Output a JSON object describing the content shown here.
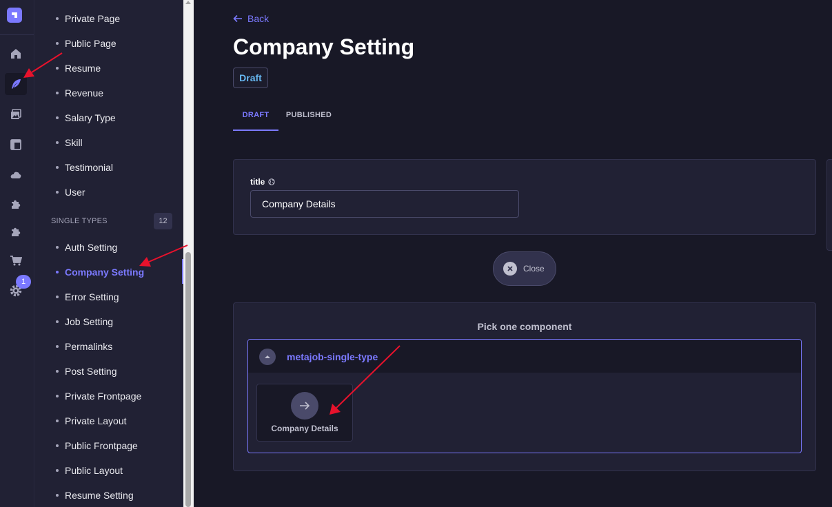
{
  "rail": {
    "items": [
      "home-icon",
      "feather-icon",
      "media-icon",
      "layout-icon",
      "cloud-icon",
      "puzzle-icon",
      "puzzle-icon",
      "cart-icon",
      "gear-icon"
    ],
    "settings_badge": "1"
  },
  "sidebar": {
    "collection_items": [
      "Private Page",
      "Public Page",
      "Resume",
      "Revenue",
      "Salary Type",
      "Skill",
      "Testimonial",
      "User"
    ],
    "single_types_label": "SINGLE TYPES",
    "single_types_count": "12",
    "single_items": [
      "Auth Setting",
      "Company Setting",
      "Error Setting",
      "Job Setting",
      "Permalinks",
      "Post Setting",
      "Private Frontpage",
      "Private Layout",
      "Public Frontpage",
      "Public Layout",
      "Resume Setting"
    ],
    "active_item": "Company Setting"
  },
  "header": {
    "back_label": "Back",
    "title": "Company Setting",
    "status": "Draft"
  },
  "tabs": [
    {
      "label": "DRAFT",
      "active": true
    },
    {
      "label": "PUBLISHED",
      "active": false
    }
  ],
  "form": {
    "title_label": "title",
    "title_value": "Company Details"
  },
  "close_button": {
    "label": "Close"
  },
  "picker": {
    "title": "Pick one component",
    "group_name": "metajob-single-type",
    "components": [
      {
        "label": "Company Details",
        "icon": "arrow-right-icon"
      }
    ]
  },
  "colors": {
    "background": "#181826",
    "panel": "#212134",
    "accent": "#7b79ff",
    "draft_badge": "#66b7f1",
    "annotation": "#e8122c"
  }
}
